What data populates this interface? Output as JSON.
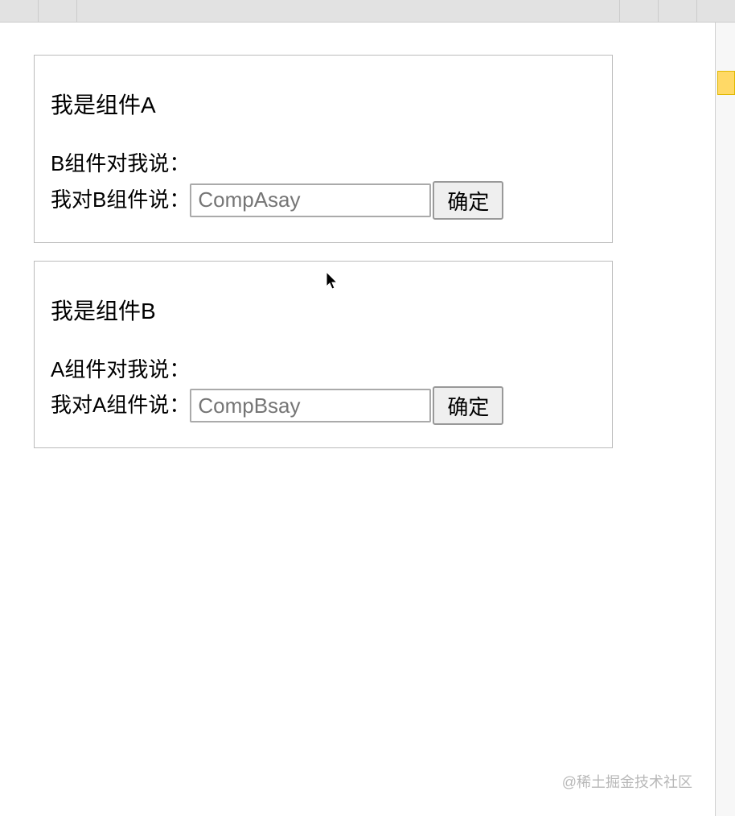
{
  "componentA": {
    "title": "我是组件A",
    "receivedLabel": "B组件对我说：",
    "receivedValue": "",
    "sendLabel": "我对B组件说：",
    "inputPlaceholder": "CompAsay",
    "inputValue": "",
    "buttonLabel": "确定"
  },
  "componentB": {
    "title": "我是组件B",
    "receivedLabel": "A组件对我说：",
    "receivedValue": "",
    "sendLabel": "我对A组件说：",
    "inputPlaceholder": "CompBsay",
    "inputValue": "",
    "buttonLabel": "确定"
  },
  "watermark": "@稀土掘金技术社区"
}
